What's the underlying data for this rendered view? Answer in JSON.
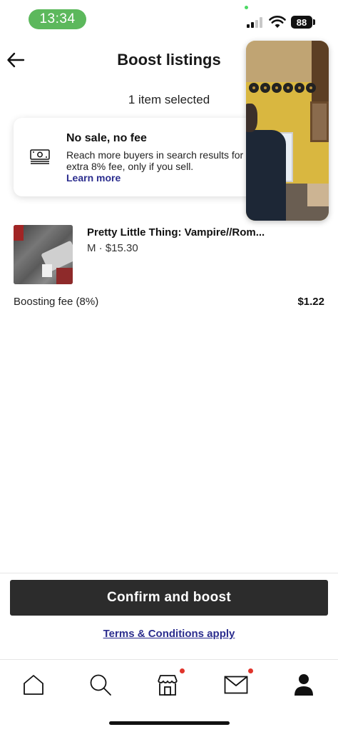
{
  "status_bar": {
    "time": "13:34",
    "battery": "88",
    "icons": [
      "signal-icon",
      "wifi-icon",
      "battery-icon"
    ]
  },
  "header": {
    "title": "Boost listings",
    "back_icon": "arrow-left-icon"
  },
  "selection": {
    "count_text": "1 item selected"
  },
  "info_card": {
    "icon": "money-bill-icon",
    "title": "No sale, no fee",
    "text": "Reach more buyers in search results for an extra 8% fee, only if you sell.",
    "link": "Learn more"
  },
  "item": {
    "title": "Pretty Little Thing: Vampire//Rom...",
    "meta": "M · $15.30"
  },
  "fee": {
    "label": "Boosting fee (8%)",
    "value": "$1.22"
  },
  "actions": {
    "confirm_label": "Confirm and boost",
    "terms_label": "Terms & Conditions apply"
  },
  "tab_bar": {
    "items": [
      {
        "name": "home",
        "icon": "home-icon",
        "badge": false
      },
      {
        "name": "search",
        "icon": "search-icon",
        "badge": false
      },
      {
        "name": "shop",
        "icon": "shop-icon",
        "badge": true
      },
      {
        "name": "inbox",
        "icon": "mail-icon",
        "badge": true
      },
      {
        "name": "profile",
        "icon": "person-icon",
        "badge": false
      }
    ]
  },
  "colors": {
    "accent_link": "#2b2d8e",
    "button_bg": "#2c2c2c",
    "badge": "#e0342b",
    "time_pill": "#5cb85c"
  }
}
